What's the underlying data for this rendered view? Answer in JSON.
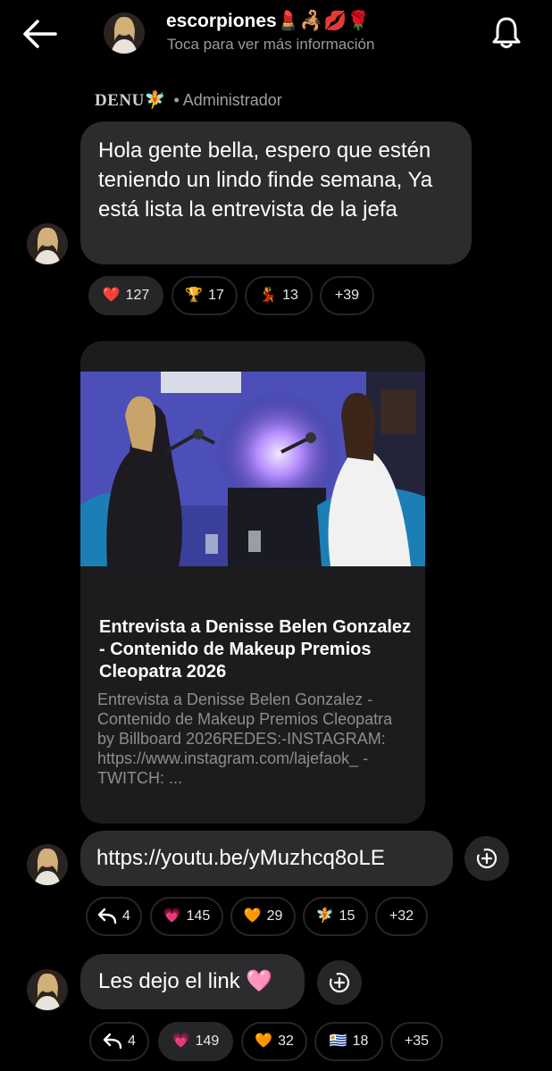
{
  "header": {
    "channel_name": "escorpiones💄🦂💋🌹",
    "subtitle": "Toca para ver más información"
  },
  "sender": {
    "name": "DENU🧚",
    "role": "• Administrador"
  },
  "messages": [
    {
      "text": "Hola gente bella, espero que estén teniendo un lindo finde semana, Ya está lista la entrevista de la jefa",
      "reactions": [
        {
          "emoji": "❤️",
          "count": "127",
          "active": true
        },
        {
          "emoji": "🏆",
          "count": "17",
          "active": false
        },
        {
          "emoji": "💃",
          "count": "13",
          "active": false
        },
        {
          "emoji": "",
          "count": "+39",
          "active": false
        }
      ]
    },
    {
      "link_preview": {
        "title": "Entrevista a Denisse Belen Gonzalez - Contenido de Makeup Premios Cleopatra 2026",
        "description": "Entrevista a Denisse Belen Gonzalez - Contenido de Makeup Premios Cleopatra by Billboard 2026REDES:-INSTAGRAM: https://www.instagram.com/lajefaok_ -TWITCH: ..."
      },
      "text": "https://youtu.be/yMuzhcq8oLE",
      "replies": "4",
      "reactions": [
        {
          "emoji": "💗",
          "count": "145",
          "active": false
        },
        {
          "emoji": "🧡",
          "count": "29",
          "active": false
        },
        {
          "emoji": "🧚",
          "count": "15",
          "active": false
        },
        {
          "emoji": "",
          "count": "+32",
          "active": false
        }
      ]
    },
    {
      "text": "Les dejo el link 🩷",
      "replies": "4",
      "reactions": [
        {
          "emoji": "💗",
          "count": "149",
          "active": true
        },
        {
          "emoji": "🧡",
          "count": "32",
          "active": false
        },
        {
          "emoji": "🇺🇾",
          "count": "18",
          "active": false
        },
        {
          "emoji": "",
          "count": "+35",
          "active": false
        }
      ]
    }
  ],
  "icons": {
    "back": "back-arrow-icon",
    "bell": "bell-icon",
    "forward": "forward-icon",
    "reply": "reply-icon"
  },
  "colors": {
    "background": "#000000",
    "bubble": "#2c2c2e",
    "card": "#1c1c1e",
    "muted_text": "#8d8d8f"
  }
}
